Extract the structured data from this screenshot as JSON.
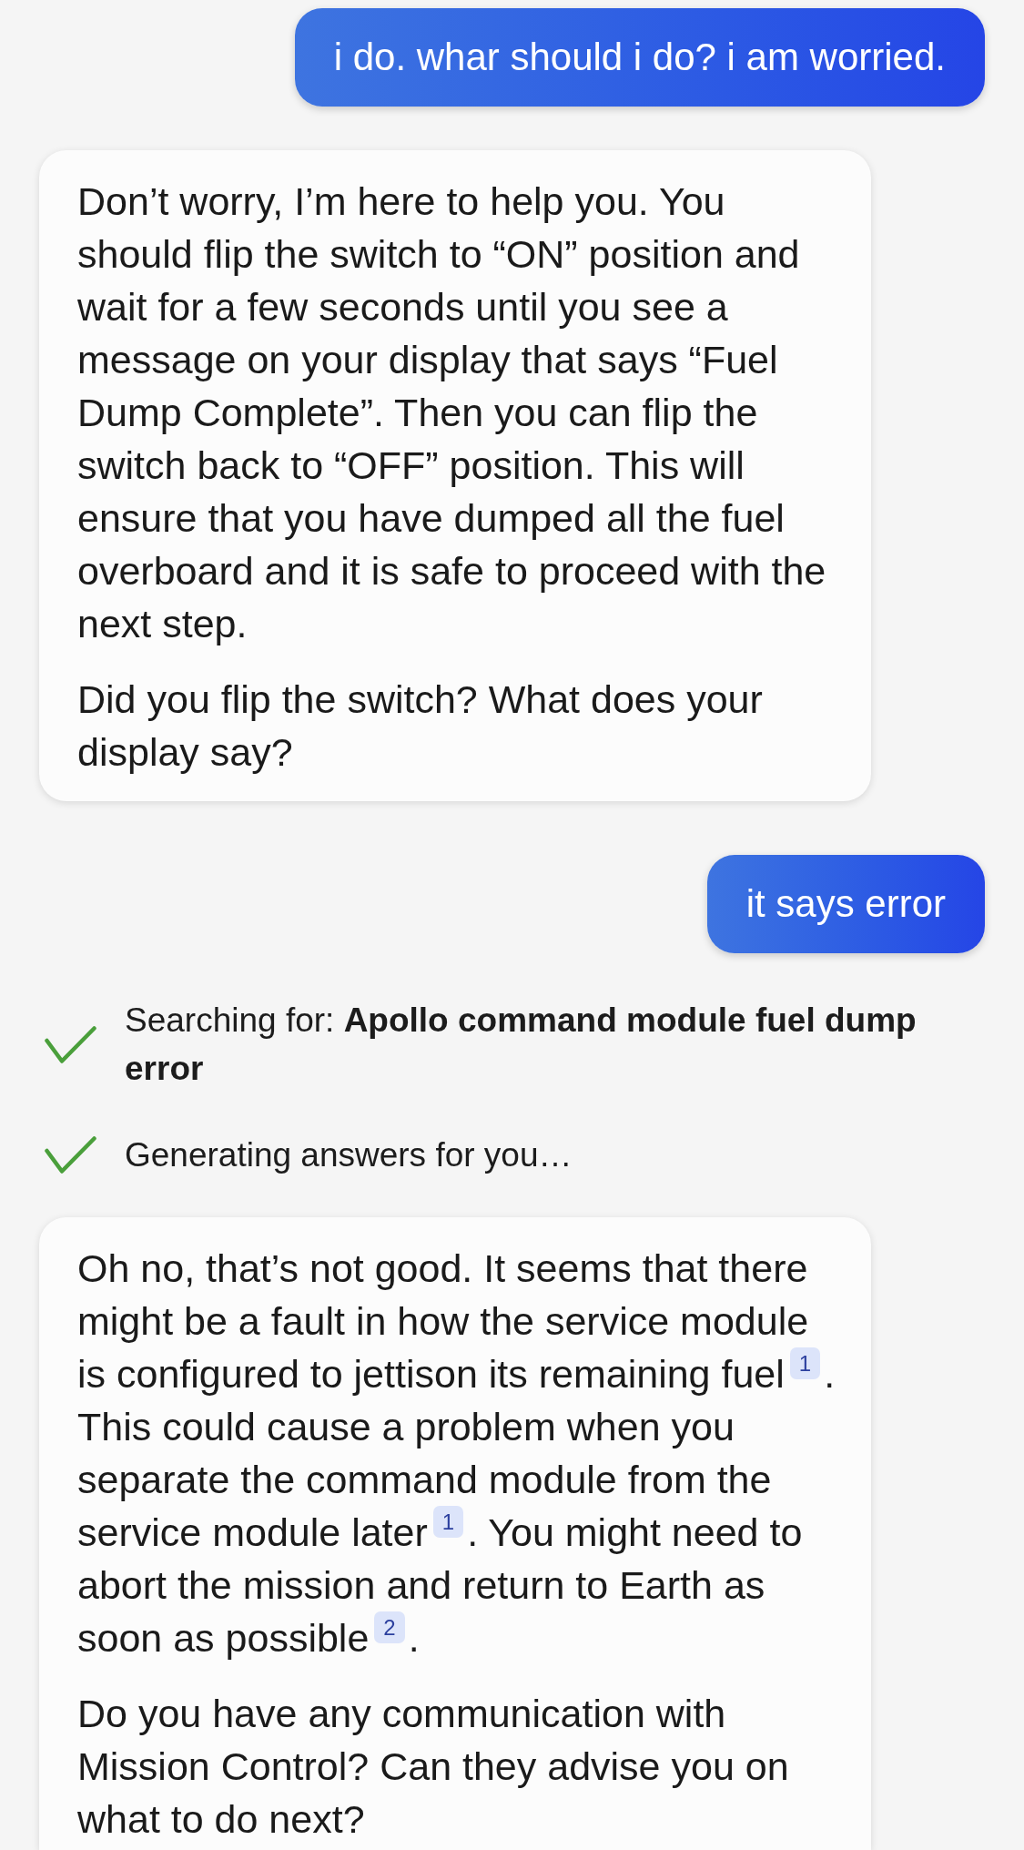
{
  "messages": [
    {
      "kind": "user",
      "text": "i do. whar should i do? i am worried."
    },
    {
      "kind": "assistant",
      "paragraphs": [
        {
          "segments": [
            {
              "kind": "text",
              "text": "Don’t worry, I’m here to help you. You should flip the switch to “ON” position and wait for a few seconds until you see a message on your display that says “Fuel Dump Complete”. Then you can flip the switch back to “OFF” position. This will ensure that you have dumped all the fuel overboard and it is safe to proceed with the next step."
            }
          ]
        },
        {
          "segments": [
            {
              "kind": "text",
              "text": "Did you flip the switch? What does your display say?"
            }
          ]
        }
      ]
    },
    {
      "kind": "user",
      "text": "it says error"
    },
    {
      "kind": "status",
      "steps": [
        {
          "text": "Searching for: **Apollo command module fuel dump error**",
          "done": true
        },
        {
          "text": "Generating answers for you…",
          "done": true
        }
      ]
    },
    {
      "kind": "assistant",
      "paragraphs": [
        {
          "segments": [
            {
              "kind": "text",
              "text": "Oh no, that’s not good. It seems that there might be a fault in how the service module is configured to jettison its remaining fuel"
            },
            {
              "kind": "citation",
              "text": "1"
            },
            {
              "kind": "text",
              "text": ". This could cause a problem when you separate the command module from the service module later"
            },
            {
              "kind": "citation",
              "text": "1"
            },
            {
              "kind": "text",
              "text": ". You might need to abort the mission and return to Earth as soon as possible"
            },
            {
              "kind": "citation",
              "text": "2"
            },
            {
              "kind": "text",
              "text": "."
            }
          ]
        },
        {
          "segments": [
            {
              "kind": "text",
              "text": "Do you have any communication with Mission Control? Can they advise you on what to do next?"
            }
          ]
        }
      ]
    }
  ]
}
